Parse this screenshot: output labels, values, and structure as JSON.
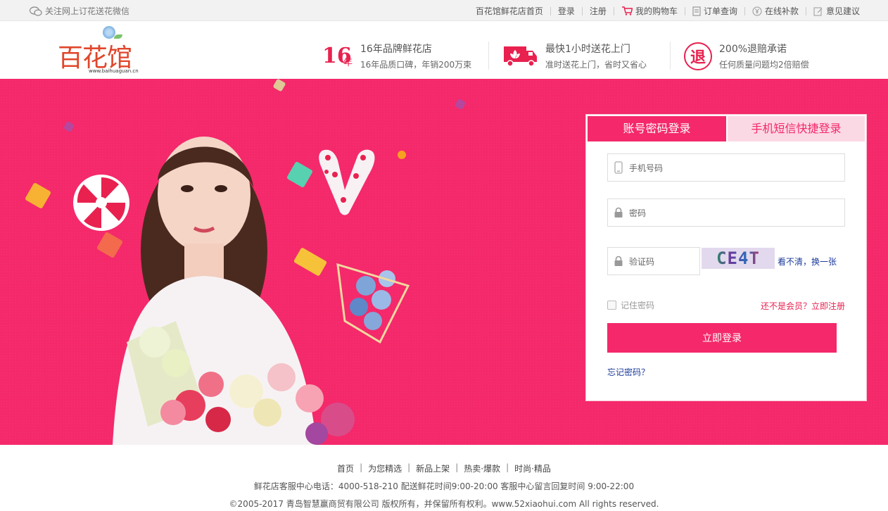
{
  "topbar": {
    "wechat_label": "关注网上订花送花微信",
    "home_label": "百花馆鲜花店首页",
    "login_label": "登录",
    "register_label": "注册",
    "cart_label": "我的购物车",
    "order_query_label": "订单查询",
    "refund_label": "在线补款",
    "feedback_label": "意见建议"
  },
  "header": {
    "logo_text": "百花馆",
    "logo_url": "www.baihuaguan.cn",
    "promo1": {
      "badge": "16",
      "badge_suffix": "年",
      "title": "16年品牌鲜花店",
      "subtitle": "16年品质口碑，年销200万束"
    },
    "promo2": {
      "title": "最快1小时送花上门",
      "subtitle": "准时送花上门，省时又省心"
    },
    "promo3": {
      "icon_text": "退",
      "title": "200%退赔承诺",
      "subtitle": "任何质量问题均2倍赔偿"
    }
  },
  "login": {
    "tab_password": "账号密码登录",
    "tab_sms": "手机短信快捷登录",
    "phone_placeholder": "手机号码",
    "password_placeholder": "密码",
    "captcha_placeholder": "验证码",
    "captcha_text": "CE4T",
    "captcha_refresh": "看不清，换一张",
    "remember_label": "记住密码",
    "register_prompt": "还不是会员？立即注册",
    "submit_label": "立即登录",
    "forgot_label": "忘记密码？"
  },
  "footer": {
    "links": [
      "首页",
      "为您精选",
      "新品上架",
      "热卖·爆款",
      "时尚·精品"
    ],
    "service_line": "鲜花店客服中心电话：4000-518-210 配送鲜花时间9:00-20:00 客服中心留言回复时间 9:00-22:00",
    "copyright": "©2005-2017 青岛智慧赢商贸有限公司 版权所有，并保留所有权利。www.52xiaohui.com All rights reserved."
  },
  "colors": {
    "brand": "#f4286a",
    "link": "#1b3a9a"
  }
}
